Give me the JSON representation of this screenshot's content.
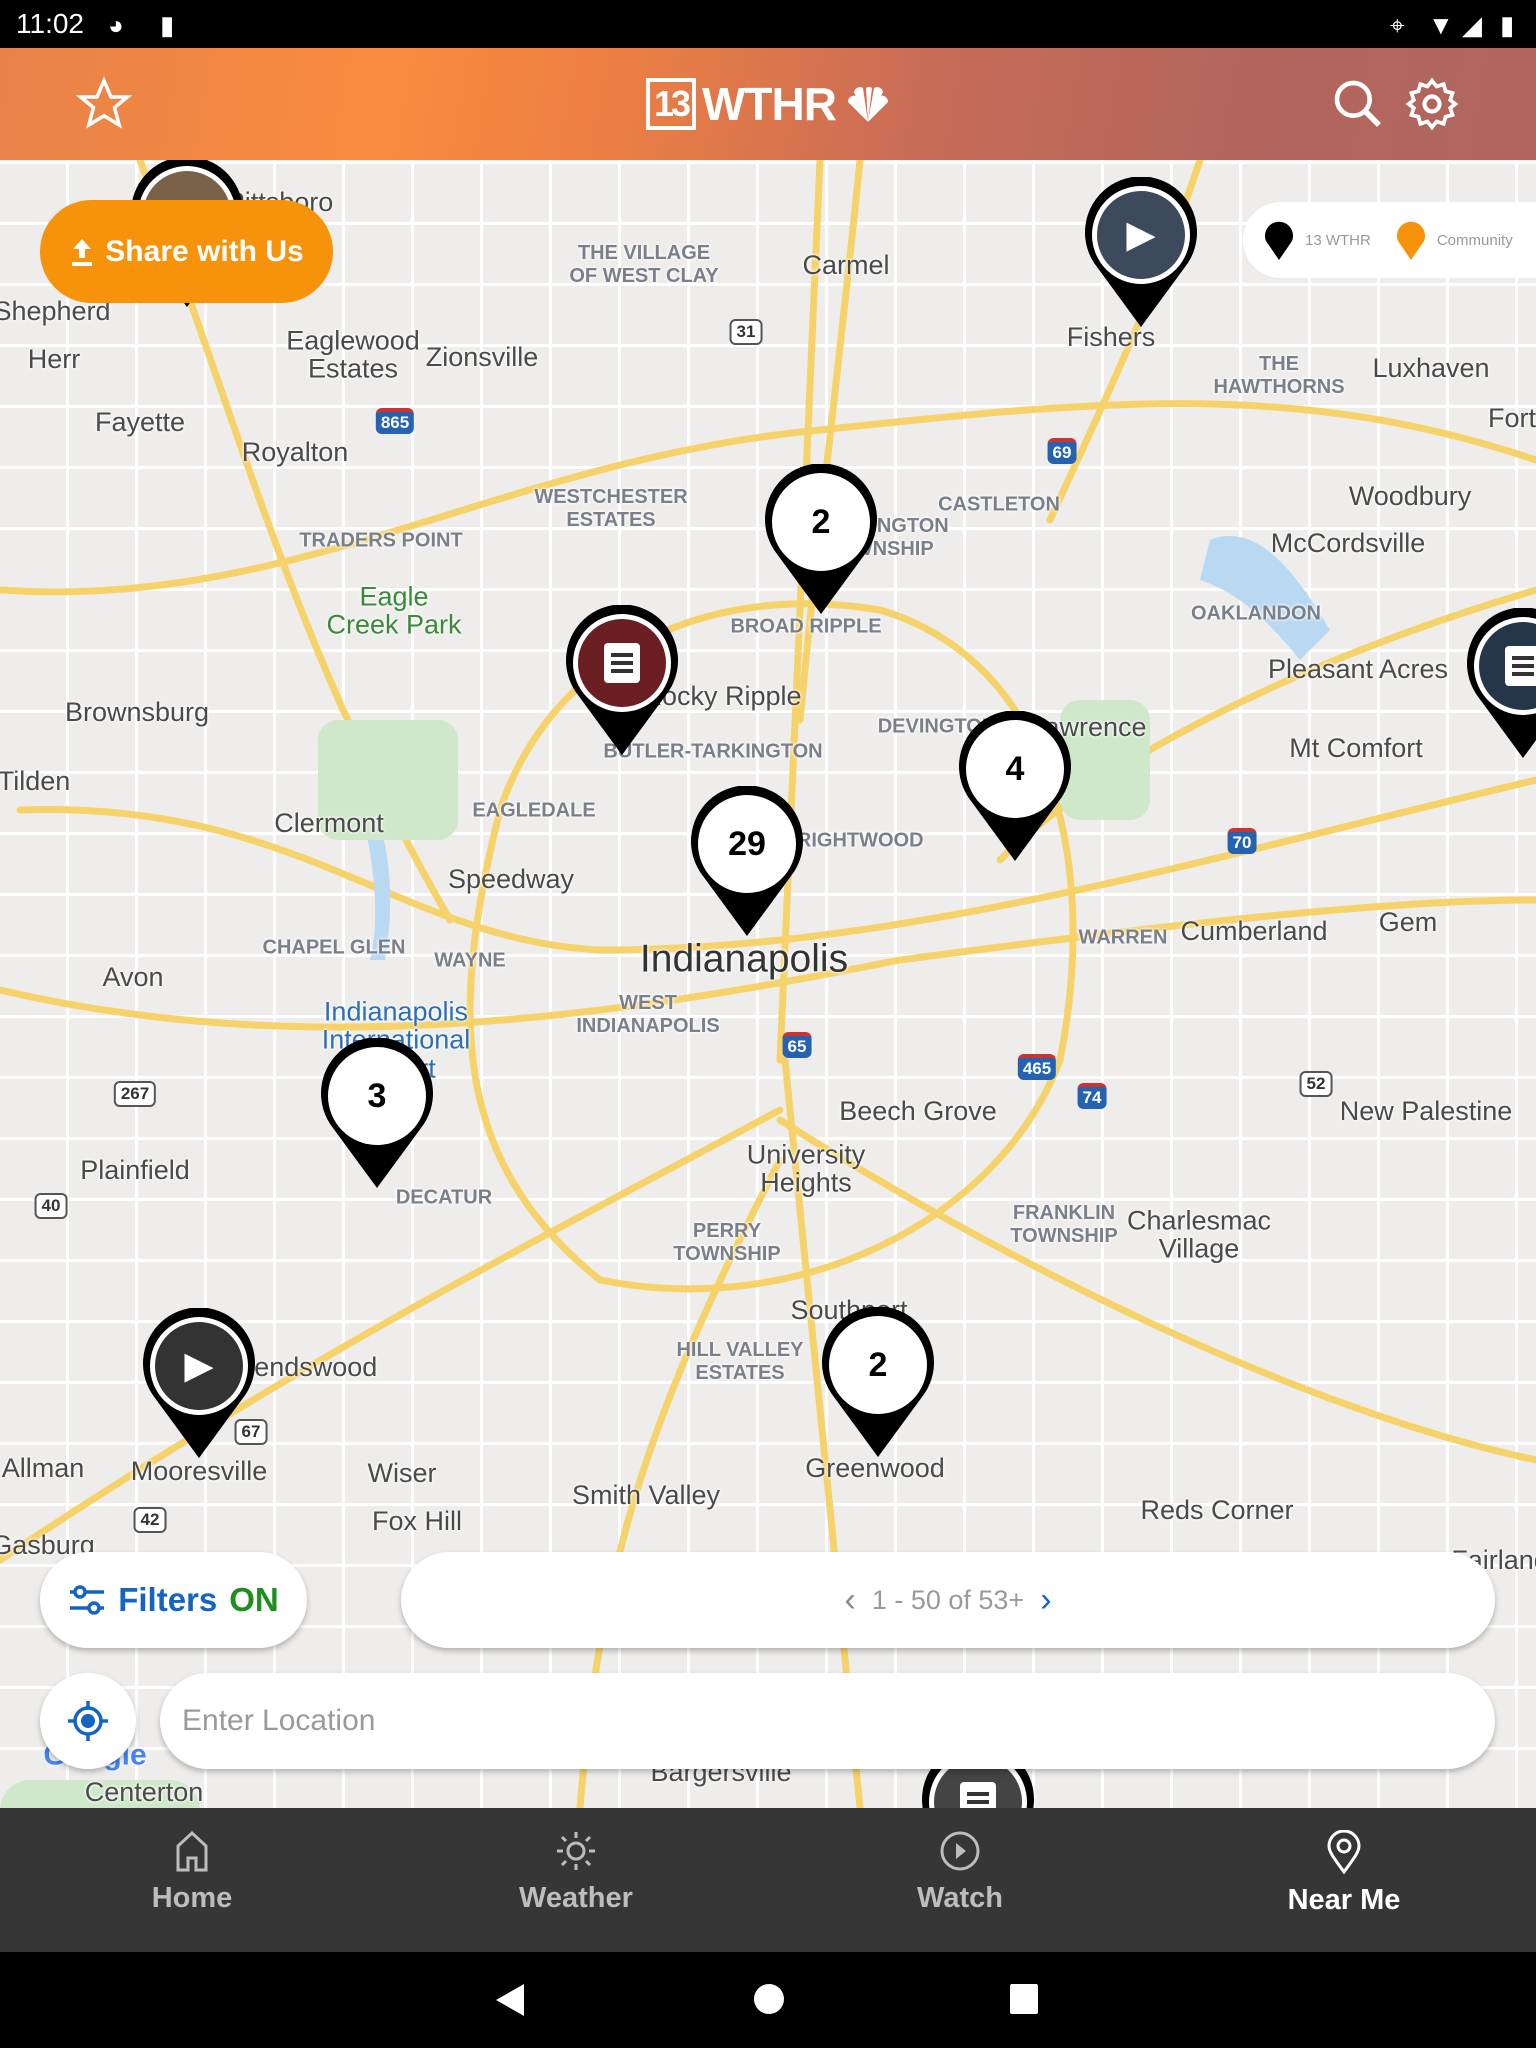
{
  "status_bar": {
    "time": "11:02"
  },
  "header": {
    "logo_text": "WTHR",
    "logo_number": "13",
    "icons": [
      "star-icon",
      "search-icon",
      "gear-icon"
    ]
  },
  "map": {
    "places": [
      "Carmel",
      "Fishers",
      "Zionsville",
      "Eaglewood\nEstates",
      "Shepherd",
      "Herr",
      "Fayette",
      "Royalton",
      "Luxhaven",
      "Fort",
      "Woodbury",
      "McCordsville",
      "Pleasant Acres",
      "Mt Comfort",
      "Brownsburg",
      "Tilden",
      "Clermont",
      "Speedway",
      "Avon",
      "Cumberland",
      "Gem",
      "New Palestine",
      "Beech Grove",
      "University\nHeights",
      "Plainfield",
      "Charlesmac\nVillage",
      "Southport",
      "Friendswood",
      "Mooresville",
      "Allman",
      "Wiser",
      "Fox Hill",
      "Smith Valley",
      "Greenwood",
      "Reds Corner",
      "Gasburg",
      "Fairland",
      "Centerton",
      "Bargersville",
      "Rocky Ripple",
      "Lawrence",
      "Pittsboro"
    ],
    "city": "Indianapolis",
    "park": "Eagle\nCreek Park",
    "airport": "Indianapolis\nInternational\nAirport",
    "neighborhoods": [
      "THE VILLAGE\nOF WEST CLAY",
      "THE\nHAWTHORNS",
      "WESTCHESTER\nESTATES",
      "TRADERS POINT",
      "CASTLETON",
      "BROAD RIPPLE",
      "OAKLANDON",
      "BUTLER-TARKINGTON",
      "EAGLEDALE",
      "CHAPEL GLEN",
      "WAYNE",
      "WARREN",
      "WEST\nINDIANAPOLIS",
      "DECATUR",
      "PERRY\nTOWNSHIP",
      "FRANKLIN\nTOWNSHIP",
      "HILL VALLEY\nESTATES",
      "DEVINGTON",
      "BRIGHTWOOD",
      "WASHINGTON\nTOWNSHIP"
    ],
    "shields": [
      "31",
      "865",
      "69",
      "70",
      "465",
      "74",
      "65",
      "52",
      "267",
      "40",
      "67",
      "42"
    ],
    "clusters": [
      "2",
      "29",
      "4",
      "3",
      "2"
    ],
    "media_markers": [
      "photo",
      "video",
      "article",
      "article",
      "video",
      "article"
    ],
    "google_mark": "Google"
  },
  "share_button": {
    "label": "Share with Us"
  },
  "legend": {
    "wthr": "13 WTHR",
    "community": "Community",
    "wthr_color": "#000000",
    "community_color": "#f7930a"
  },
  "filters": {
    "label": "Filters",
    "state": "ON",
    "label_color": "#1565c0",
    "state_color": "#1e8e1e"
  },
  "pagination": {
    "text": "1 - 50 of 53+"
  },
  "location_input": {
    "placeholder": "Enter Location",
    "value": ""
  },
  "bottom_nav": {
    "items": [
      {
        "label": "Home"
      },
      {
        "label": "Weather"
      },
      {
        "label": "Watch"
      },
      {
        "label": "Near Me",
        "active": true
      }
    ]
  },
  "colors": {
    "accent": "#f7930a",
    "nav_bg": "#363636"
  }
}
